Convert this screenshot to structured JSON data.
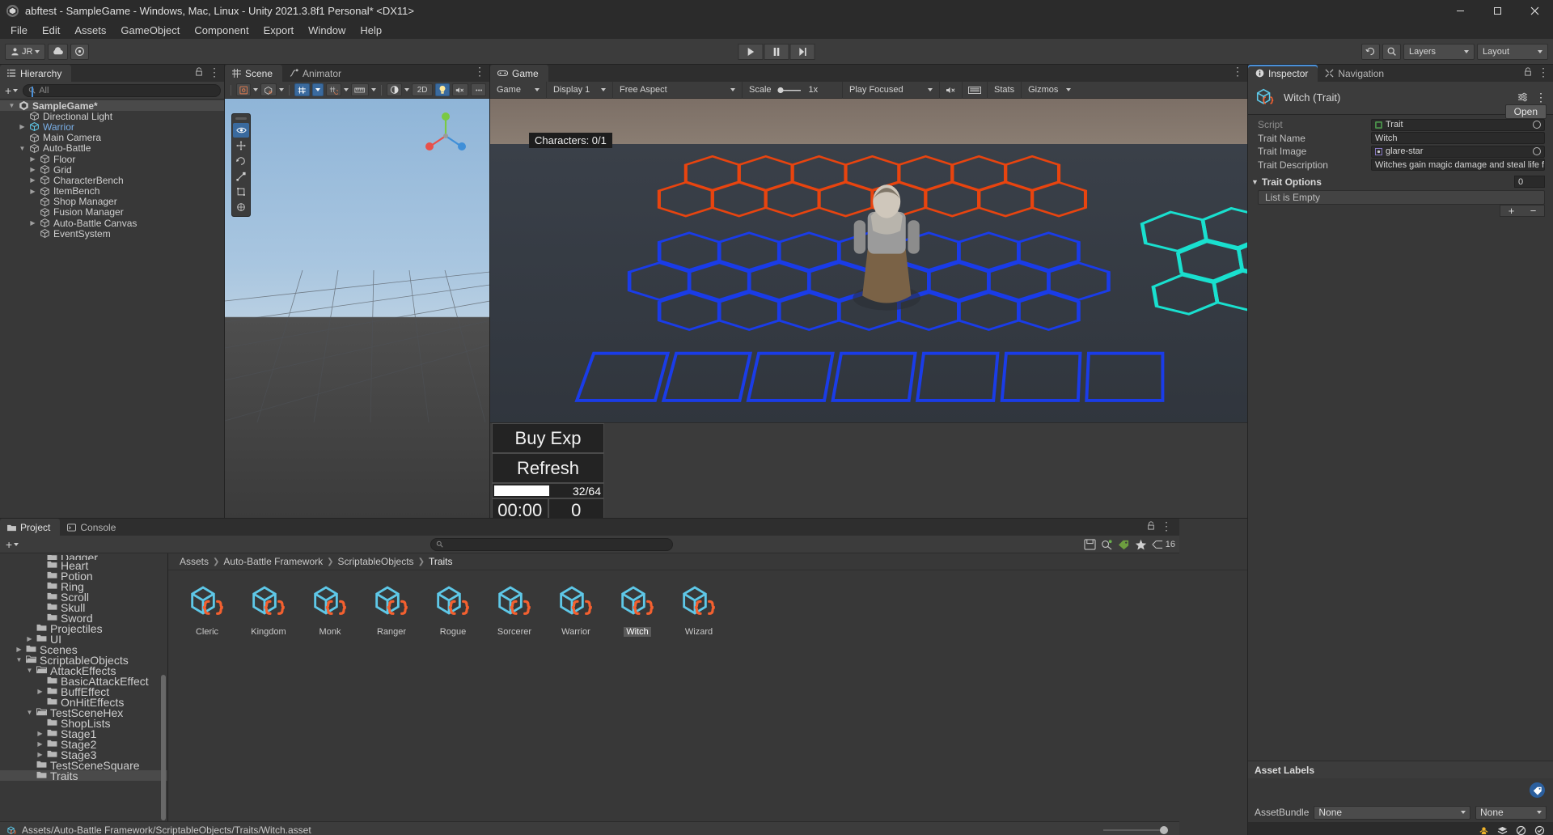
{
  "window": {
    "title": "abftest - SampleGame - Windows, Mac, Linux - Unity 2021.3.8f1 Personal* <DX11>",
    "minimize": "–",
    "maximize": "□",
    "close": "✕"
  },
  "menubar": {
    "items": [
      "File",
      "Edit",
      "Assets",
      "GameObject",
      "Component",
      "Export",
      "Window",
      "Help"
    ]
  },
  "toolbar": {
    "account": "JR",
    "cloud_icon": "cloud-icon",
    "services_icon": "services-icon",
    "play": "▶",
    "pause": "❚❚",
    "step": "▶❘",
    "history_icon": "undo-history-icon",
    "search_icon": "search-icon",
    "layers_label": "Layers",
    "layout_label": "Layout"
  },
  "hierarchy": {
    "tab": "Hierarchy",
    "search_placeholder": "All",
    "add_label": "+",
    "items": [
      {
        "label": "SampleGame*",
        "depth": 0,
        "arrow": "down",
        "icon": "unity-scene-icon",
        "selected": true,
        "highlight": false
      },
      {
        "label": "Directional Light",
        "depth": 1,
        "arrow": "none",
        "icon": "gameobject-icon",
        "selected": false,
        "highlight": false
      },
      {
        "label": "Warrior",
        "depth": 1,
        "arrow": "right",
        "icon": "prefab-icon",
        "selected": false,
        "highlight": true
      },
      {
        "label": "Main Camera",
        "depth": 1,
        "arrow": "none",
        "icon": "gameobject-icon",
        "selected": false,
        "highlight": false
      },
      {
        "label": "Auto-Battle",
        "depth": 1,
        "arrow": "down",
        "icon": "gameobject-icon",
        "selected": false,
        "highlight": false
      },
      {
        "label": "Floor",
        "depth": 2,
        "arrow": "right",
        "icon": "gameobject-icon",
        "selected": false,
        "highlight": false
      },
      {
        "label": "Grid",
        "depth": 2,
        "arrow": "right",
        "icon": "gameobject-icon",
        "selected": false,
        "highlight": false
      },
      {
        "label": "CharacterBench",
        "depth": 2,
        "arrow": "right",
        "icon": "gameobject-icon",
        "selected": false,
        "highlight": false
      },
      {
        "label": "ItemBench",
        "depth": 2,
        "arrow": "right",
        "icon": "gameobject-icon",
        "selected": false,
        "highlight": false
      },
      {
        "label": "Shop Manager",
        "depth": 2,
        "arrow": "none",
        "icon": "gameobject-icon",
        "selected": false,
        "highlight": false
      },
      {
        "label": "Fusion Manager",
        "depth": 2,
        "arrow": "none",
        "icon": "gameobject-icon",
        "selected": false,
        "highlight": false
      },
      {
        "label": "Auto-Battle Canvas",
        "depth": 2,
        "arrow": "right",
        "icon": "gameobject-icon",
        "selected": false,
        "highlight": false
      },
      {
        "label": "EventSystem",
        "depth": 2,
        "arrow": "none",
        "icon": "gameobject-icon",
        "selected": false,
        "highlight": false
      }
    ]
  },
  "scene": {
    "tabs": [
      {
        "label": "Scene",
        "icon": "scene-grid-icon",
        "active": true
      },
      {
        "label": "Animator",
        "icon": "animator-icon",
        "active": false
      }
    ],
    "toolbar": {
      "draw_mode": "shaded-mode-icon",
      "gizmo_mode": "2d-gizmo-icon",
      "grid_toggle": "grid-snap-icon",
      "snap_increment": "snap-increment-icon",
      "scale_gizmo": "ruler-icon",
      "lighting": "lighting-icon",
      "twod_label": "2D",
      "light_toggle": "light-bulb-icon",
      "audio_toggle": "audio-mute-icon",
      "more": "scene-overflow-icon"
    },
    "tools": [
      "eye-visibility-icon",
      "move-tool-icon",
      "rotate-tool-icon",
      "scale-tool-icon",
      "rect-tool-icon",
      "transform-tool-icon"
    ],
    "gizmo_axes": [
      "X",
      "Y",
      "Z"
    ]
  },
  "game": {
    "tab": "Game",
    "toolbar": {
      "view_label": "Game",
      "display_label": "Display 1",
      "aspect_label": "Free Aspect",
      "scale_label": "Scale",
      "scale_value": "1x",
      "play_mode_label": "Play Focused",
      "mute_icon": "audio-mute-icon",
      "vsync_icon": "vsync-icon",
      "stats_label": "Stats",
      "gizmos_label": "Gizmos"
    },
    "overlay": {
      "characters_label": "Characters: 0/1"
    },
    "ui": {
      "buy_exp": "Buy Exp",
      "refresh": "Refresh",
      "exp_value": "32/64",
      "exp_percent": 50,
      "timer": "00:00",
      "gold": "0"
    }
  },
  "inspector": {
    "tabs": [
      {
        "label": "Inspector",
        "icon": "info-icon",
        "active": true
      },
      {
        "label": "Navigation",
        "icon": "navigation-icon",
        "active": false
      }
    ],
    "lock_icon": "lock-icon",
    "menu_icon": "kebab-menu-icon",
    "object_title": "Witch (Trait)",
    "object_icon": "scriptable-object-icon",
    "open_button": "Open",
    "fields": [
      {
        "label": "Script",
        "value": "Trait",
        "type": "object",
        "icon": "cs-script-icon",
        "dim": true
      },
      {
        "label": "Trait Name",
        "value": "Witch",
        "type": "text",
        "icon": "",
        "dim": false
      },
      {
        "label": "Trait Image",
        "value": "glare-star",
        "type": "object",
        "icon": "sprite-icon",
        "dim": false
      },
      {
        "label": "Trait Description",
        "value": "Witches gain magic damage and steal life from",
        "type": "text",
        "icon": "",
        "dim": false
      }
    ],
    "trait_options": {
      "label": "Trait Options",
      "count": "0",
      "empty_text": "List is Empty",
      "add_label": "+",
      "remove_label": "−"
    },
    "asset_labels_header": "Asset Labels",
    "tag_icon": "label-tag-icon",
    "assetbundle_label": "AssetBundle",
    "assetbundle_value": "None",
    "assetbundle_variant": "None",
    "footer_icons": [
      "animation-icon",
      "layers-stack-icon",
      "no-preview-icon",
      "check-circle-icon"
    ]
  },
  "project": {
    "tabs": [
      {
        "label": "Project",
        "icon": "project-folder-icon",
        "active": true
      },
      {
        "label": "Console",
        "icon": "console-icon",
        "active": false
      }
    ],
    "add_label": "+",
    "search_placeholder": "",
    "search_icon": "search-icon",
    "filters": [
      "save-search-icon",
      "type-filter-icon",
      "label-filter-icon",
      "favorite-icon"
    ],
    "item_count": "16",
    "tree": [
      {
        "label": "Dagger",
        "depth": 3,
        "arrow": "none",
        "open": false,
        "clipped": true
      },
      {
        "label": "Heart",
        "depth": 3,
        "arrow": "none",
        "open": false
      },
      {
        "label": "Potion",
        "depth": 3,
        "arrow": "none",
        "open": false
      },
      {
        "label": "Ring",
        "depth": 3,
        "arrow": "none",
        "open": false
      },
      {
        "label": "Scroll",
        "depth": 3,
        "arrow": "none",
        "open": false
      },
      {
        "label": "Skull",
        "depth": 3,
        "arrow": "none",
        "open": false
      },
      {
        "label": "Sword",
        "depth": 3,
        "arrow": "none",
        "open": false
      },
      {
        "label": "Projectiles",
        "depth": 2,
        "arrow": "none",
        "open": false
      },
      {
        "label": "UI",
        "depth": 2,
        "arrow": "right",
        "open": false
      },
      {
        "label": "Scenes",
        "depth": 1,
        "arrow": "right",
        "open": false
      },
      {
        "label": "ScriptableObjects",
        "depth": 1,
        "arrow": "down",
        "open": true
      },
      {
        "label": "AttackEffects",
        "depth": 2,
        "arrow": "down",
        "open": true
      },
      {
        "label": "BasicAttackEffect",
        "depth": 3,
        "arrow": "none",
        "open": false
      },
      {
        "label": "BuffEffect",
        "depth": 3,
        "arrow": "right",
        "open": false
      },
      {
        "label": "OnHitEffects",
        "depth": 3,
        "arrow": "none",
        "open": false
      },
      {
        "label": "TestSceneHex",
        "depth": 2,
        "arrow": "down",
        "open": true
      },
      {
        "label": "ShopLists",
        "depth": 3,
        "arrow": "none",
        "open": false
      },
      {
        "label": "Stage1",
        "depth": 3,
        "arrow": "right",
        "open": false
      },
      {
        "label": "Stage2",
        "depth": 3,
        "arrow": "right",
        "open": false
      },
      {
        "label": "Stage3",
        "depth": 3,
        "arrow": "right",
        "open": false
      },
      {
        "label": "TestSceneSquare",
        "depth": 2,
        "arrow": "none",
        "open": false
      },
      {
        "label": "Traits",
        "depth": 2,
        "arrow": "none",
        "open": false,
        "selected": true
      }
    ],
    "breadcrumb": [
      "Assets",
      "Auto-Battle Framework",
      "ScriptableObjects",
      "Traits"
    ],
    "assets": [
      {
        "name": "Cleric",
        "icon": "scriptable-object-icon",
        "selected": false
      },
      {
        "name": "Kingdom",
        "icon": "scriptable-object-icon",
        "selected": false
      },
      {
        "name": "Monk",
        "icon": "scriptable-object-icon",
        "selected": false
      },
      {
        "name": "Ranger",
        "icon": "scriptable-object-icon",
        "selected": false
      },
      {
        "name": "Rogue",
        "icon": "scriptable-object-icon",
        "selected": false
      },
      {
        "name": "Sorcerer",
        "icon": "scriptable-object-icon",
        "selected": false
      },
      {
        "name": "Warrior",
        "icon": "scriptable-object-icon",
        "selected": false
      },
      {
        "name": "Witch",
        "icon": "scriptable-object-icon",
        "selected": true
      },
      {
        "name": "Wizard",
        "icon": "scriptable-object-icon",
        "selected": false
      }
    ],
    "status_path": "Assets/Auto-Battle Framework/ScriptableObjects/Traits/Witch.asset",
    "status_icon": "scriptable-object-icon"
  },
  "colors": {
    "accent_blue": "#4a90d9",
    "panel_bg": "#383838",
    "toolbar_bg": "#3c3c3c",
    "icon_cyan": "#5ec8e8",
    "icon_orange": "#f4602f",
    "hierarchy_highlight": "#7ab0e8"
  }
}
